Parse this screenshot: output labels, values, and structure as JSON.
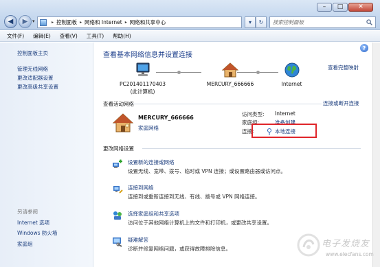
{
  "window": {
    "minimize_glyph": "–",
    "maximize_glyph": "□",
    "close_glyph": "✕"
  },
  "address_bar": {
    "breadcrumbs": [
      "控制面板",
      "网络和 Internet",
      "网络和共享中心"
    ],
    "search_placeholder": "搜索控制面板"
  },
  "menu": [
    "文件(F)",
    "编辑(E)",
    "查看(V)",
    "工具(T)",
    "帮助(H)"
  ],
  "sidebar": {
    "home": "控制面板主页",
    "tasks": [
      "管理无线网络",
      "更改适配器设置",
      "更改高级共享设置"
    ],
    "see_also_header": "另请参阅",
    "see_also": [
      "Internet 选项",
      "Windows 防火墙",
      "家庭组"
    ]
  },
  "main": {
    "title": "查看基本网络信息并设置连接",
    "view_full_map": "查看完整映射",
    "network_map": {
      "computer": {
        "line1": "PC201401170403",
        "line2": "(此计算机)"
      },
      "router": {
        "line1": "MERCURY_666666"
      },
      "internet": {
        "line1": "Internet"
      }
    },
    "active_networks": {
      "header": "查看活动网络",
      "connect_link": "连接或断开连接",
      "network_name": "MERCURY_666666",
      "network_type": "家庭网络",
      "access_type_label": "访问类型:",
      "access_type_value": "Internet",
      "homegroup_label": "家庭组:",
      "homegroup_value": "准备创建",
      "connections_label": "连接:",
      "connections_value": "本地连接"
    },
    "change_settings": {
      "header": "更改网络设置",
      "tasks": [
        {
          "title": "设置新的连接或网络",
          "desc": "设置无线、宽带、拨号、临时或 VPN 连接；或设置路由器或访问点。"
        },
        {
          "title": "连接到网络",
          "desc": "连接到或重新连接到无线、有线、拨号或 VPN 网络连接。"
        },
        {
          "title": "选择家庭组和共享选项",
          "desc": "访问位于其他网络计算机上的文件和打印机，或更改共享设置。"
        },
        {
          "title": "疑难解答",
          "desc": "诊断并修复网络问题，或获得故障排除信息。"
        }
      ]
    }
  },
  "watermark": {
    "brand": "电子发烧友",
    "url": "www.elecfans.com"
  },
  "colors": {
    "link": "#1c3e7e",
    "title": "#1a3c8a",
    "highlight_border": "#e0252a",
    "titlebar": "#c7d9ef"
  }
}
